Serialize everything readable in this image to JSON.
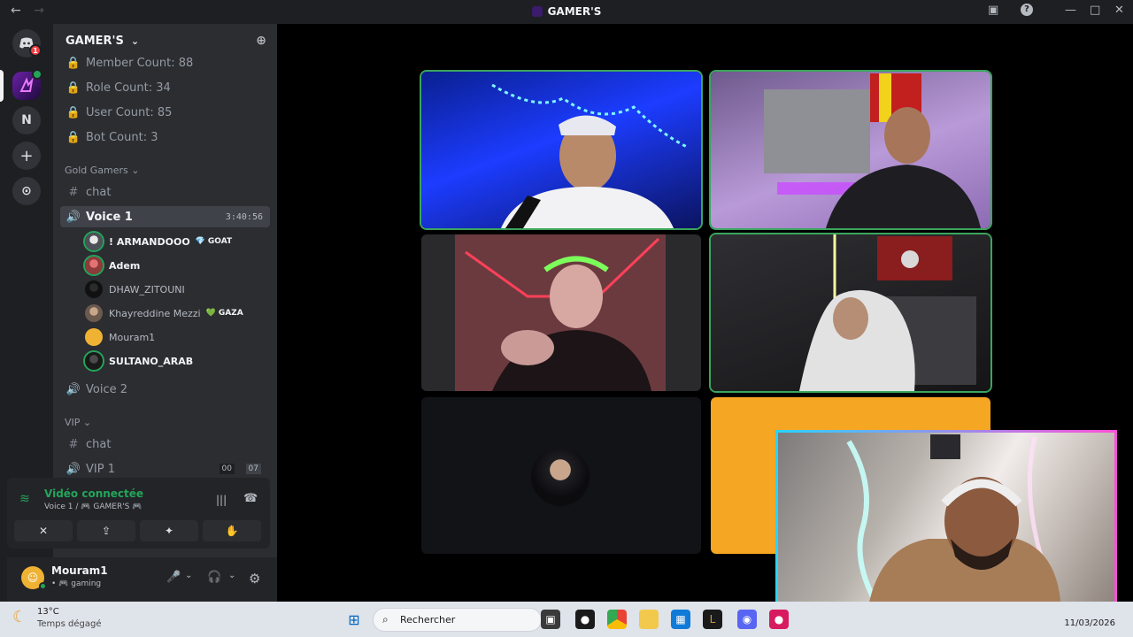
{
  "window": {
    "title": "GAMER'S",
    "back_icon": "←",
    "forward_icon": "→",
    "inbox_icon": "▣",
    "help_icon": "?",
    "minimize_icon": "—",
    "maximize_icon": "□",
    "close_icon": "✕"
  },
  "guilds": {
    "discord_badge": "1",
    "n_server": "N",
    "add_icon": "+",
    "explore_icon": "⊙"
  },
  "server": {
    "name": "GAMER'S",
    "chevron": "⌄",
    "add_member_icon": "⊕"
  },
  "channels": {
    "stats": [
      {
        "label": "Member Count: 88"
      },
      {
        "label": "Role Count: 34"
      },
      {
        "label": "User Count: 85"
      },
      {
        "label": "Bot Count: 3"
      }
    ],
    "gold_category": "Gold Gamers",
    "gold_chat": "chat",
    "voice1": {
      "label": "Voice 1",
      "timer": "3:40:56"
    },
    "voice2": "Voice 2",
    "vip_category": "VIP",
    "vip_chat": "chat",
    "vip1": {
      "label": "VIP 1",
      "count_a": "00",
      "count_b": "07"
    }
  },
  "voice_users": [
    {
      "name": "! ARMANDOOO",
      "tag": "GOAT",
      "tag_icon": "💎",
      "live": true,
      "icons": "▶"
    },
    {
      "name": "Adem",
      "tag": "",
      "tag_icon": "",
      "live": true,
      "icons": "▶ 🎮"
    },
    {
      "name": "DHAW_ZITOUNI",
      "tag": "",
      "tag_icon": "",
      "live": false,
      "icons": "🎮"
    },
    {
      "name": "Khayreddine Mezzi",
      "tag": "GAZA",
      "tag_icon": "💚",
      "live": false,
      "icons": "▶"
    },
    {
      "name": "Mouram1",
      "tag": "",
      "tag_icon": "",
      "live": false,
      "icons": "🎮"
    },
    {
      "name": "SULTANO_ARAB",
      "tag": "",
      "tag_icon": "",
      "live": true,
      "icons": "▶"
    }
  ],
  "voice_panel": {
    "status": "Vidéo connectée",
    "channel": "Voice 1 / 🎮 GAMER'S 🎮",
    "buttons": [
      "✕",
      "⇪",
      "✦",
      "✋"
    ]
  },
  "user_panel": {
    "name": "Mouram1",
    "status": "• 🎮 gaming",
    "mic_icon": "🎤",
    "headset_icon": "🎧",
    "settings_icon": "⚙"
  },
  "taskbar": {
    "temp": "13°C",
    "weather": "Temps dégagé",
    "search_placeholder": "Rechercher",
    "date": "11/03/2026"
  },
  "colors": {
    "accent_green": "#23a55a",
    "brand": "#5865f2",
    "tile_orange": "#f5a623"
  }
}
